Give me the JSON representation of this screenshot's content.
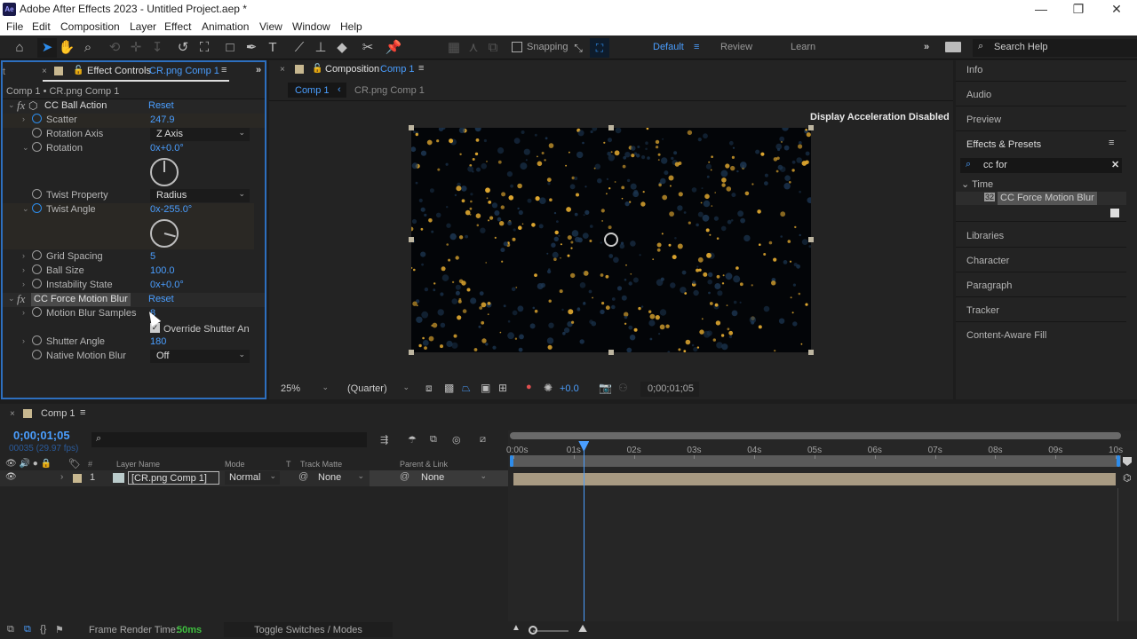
{
  "window": {
    "app_icon": "Ae",
    "title": "Adobe After Effects 2023 - Untitled Project.aep *",
    "controls": {
      "minimize": "—",
      "restore": "❐",
      "close": "✕"
    }
  },
  "menu": [
    "File",
    "Edit",
    "Composition",
    "Layer",
    "Effect",
    "Animation",
    "View",
    "Window",
    "Help"
  ],
  "toolbar": {
    "tools": [
      "home-icon",
      "selection-tool-icon",
      "hand-tool-icon",
      "zoom-tool-icon",
      "rotate-behind-icon",
      "anchor-icon",
      "pin-icon",
      "rotation-tool-icon",
      "pan-behind-icon",
      "rectangle-tool-icon",
      "pen-tool-icon",
      "type-tool-icon",
      "brush-tool-icon",
      "clone-stamp-icon",
      "eraser-icon",
      "roto-brush-icon",
      "puppet-pin-icon"
    ],
    "snapping_label": "Snapping",
    "workspaces": [
      "Default",
      "Review",
      "Learn"
    ],
    "active_workspace": "Default",
    "more": "»",
    "search_help": "Search Help"
  },
  "effect_controls": {
    "tab_left": "t",
    "tab_label": "Effect Controls",
    "tab_layer": "CR.png Comp 1",
    "more": "»",
    "breadcrumb": "Comp 1 • CR.png Comp 1",
    "effects": [
      {
        "name": "CC Ball Action",
        "reset": "Reset",
        "properties": [
          {
            "name": "Scatter",
            "value": "247.9",
            "keyed": true
          },
          {
            "name": "Rotation Axis",
            "dropdown": "Z Axis"
          },
          {
            "name": "Rotation",
            "value": "0x+0.0°",
            "dial_deg": 0
          },
          {
            "name": "Twist Property",
            "dropdown": "Radius"
          },
          {
            "name": "Twist Angle",
            "value": "0x-255.0°",
            "dial_deg": -255,
            "keyed": true
          },
          {
            "name": "Grid Spacing",
            "value": "5"
          },
          {
            "name": "Ball Size",
            "value": "100.0"
          },
          {
            "name": "Instability State",
            "value": "0x+0.0°"
          }
        ]
      },
      {
        "name": "CC Force Motion Blur",
        "reset": "Reset",
        "properties": [
          {
            "name": "Motion Blur Samples",
            "value": "8"
          },
          {
            "name": "Override Shutter Angle",
            "checkbox_label": "Override Shutter An",
            "checked": true
          },
          {
            "name": "Shutter Angle",
            "value": "180"
          },
          {
            "name": "Native Motion Blur",
            "dropdown": "Off"
          }
        ]
      }
    ]
  },
  "composition": {
    "tab_label": "Composition",
    "tab_comp": "Comp 1",
    "nav": [
      "Comp 1",
      "CR.png Comp 1"
    ],
    "notice": "Display Acceleration Disabled",
    "zoom": "25%",
    "resolution": "(Quarter)",
    "exposure": "+0.0",
    "timecode": "0;00;01;05"
  },
  "right_panels": {
    "top": [
      "Info",
      "Audio",
      "Preview"
    ],
    "effects_presets": {
      "title": "Effects & Presets",
      "search": "cc for",
      "category": "Time",
      "result": "CC Force Motion Blur",
      "result_badge": "32"
    },
    "bottom": [
      "Libraries",
      "Character",
      "Paragraph",
      "Tracker",
      "Content-Aware Fill"
    ]
  },
  "timeline": {
    "tab": "Comp 1",
    "timecode": "0;00;01;05",
    "frame_info": "00035 (29.97 fps)",
    "columns": {
      "name": "Layer Name",
      "mode": "Mode",
      "t": "T",
      "track_matte": "Track Matte",
      "parent": "Parent & Link"
    },
    "layers": [
      {
        "index": "1",
        "name": "[CR.png Comp 1]",
        "mode": "Normal",
        "track_matte": "None",
        "parent": "None"
      }
    ],
    "ruler": [
      "0:00s",
      "01s",
      "02s",
      "03s",
      "04s",
      "05s",
      "06s",
      "07s",
      "08s",
      "09s",
      "10s"
    ],
    "playhead_seconds": 1.17,
    "duration_seconds": 10
  },
  "statusbar": {
    "render_label": "Frame Render Time:",
    "render_value": "50ms",
    "toggle": "Toggle Switches / Modes"
  }
}
